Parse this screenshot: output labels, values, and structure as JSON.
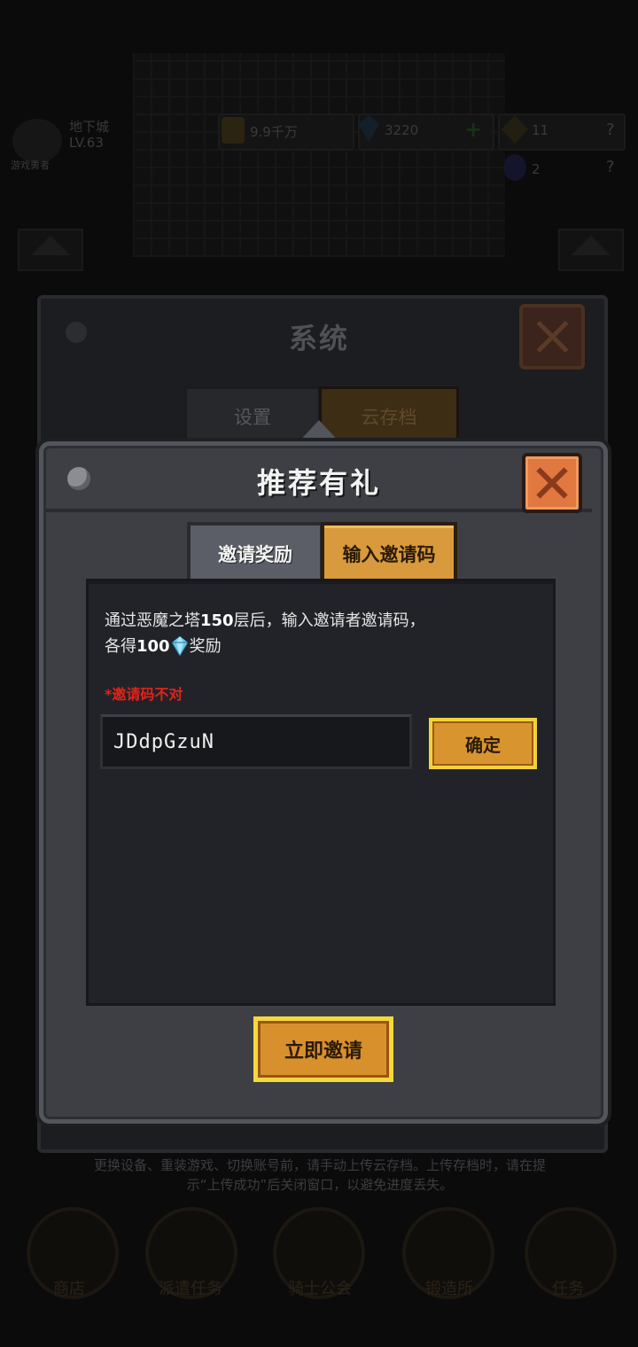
{
  "background": {
    "player_name": "地下城",
    "player_level": "LV.63",
    "player_tag": "游戏勇者",
    "gold": "9.9千万",
    "gems": "3220",
    "plus": "+",
    "keys": "11",
    "question1": "?",
    "potions": "2",
    "question2": "?",
    "nav": [
      "商店",
      "派遣任务",
      "骑士公会",
      "锻造所",
      "任务"
    ]
  },
  "system_panel": {
    "title": "系统",
    "tabs": [
      "设置",
      "云存档"
    ],
    "note": "更换设备、重装游戏、切换账号前，请手动上传云存档。上传存档时，请在提示“上传成功”后关闭窗口，以避免进度丢失。"
  },
  "dialog": {
    "title": "推荐有礼",
    "tabs": {
      "invite_reward": "邀请奖励",
      "enter_code": "输入邀请码"
    },
    "desc_line1_pre": "通过恶魔之塔",
    "desc_floor": "150",
    "desc_line1_post": "层后，输入邀请者邀请码，",
    "desc_line2_pre": "各得",
    "desc_amount": "100",
    "desc_line2_post": "奖励",
    "error_text": "*邀请码不对",
    "code_value": "JDdpGzuN",
    "confirm_label": "确定",
    "invite_now_label": "立即邀请",
    "gem_icon": "blue-gem-icon",
    "accent": "#d8952f",
    "error_color": "#e2231a"
  }
}
